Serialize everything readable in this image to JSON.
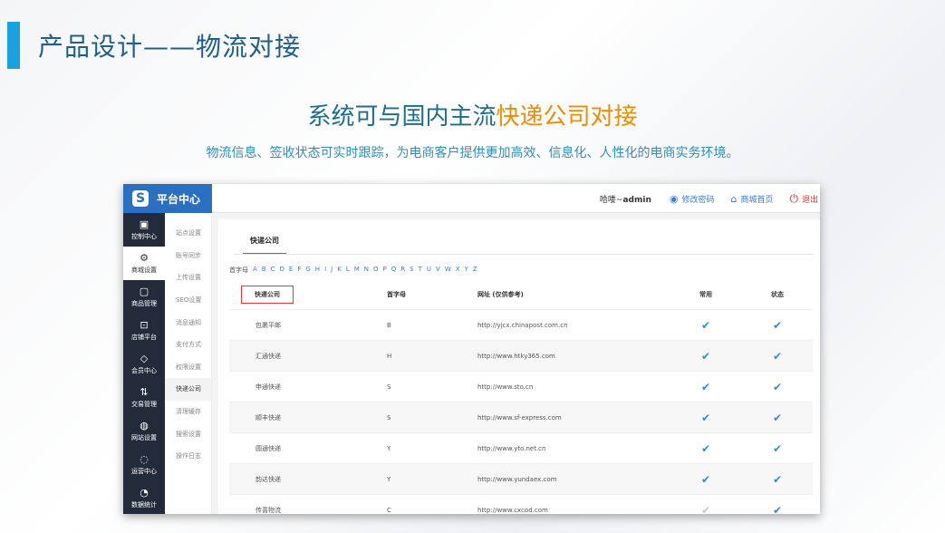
{
  "slide": {
    "title": "产品设计——物流对接",
    "headline_part1": "系统可与国内主流",
    "headline_part2": "快递公司对接",
    "subtitle": "物流信息、签收状态可实时跟踪，为电商客户提供更加高效、信息化、人性化的电商实务环境。"
  },
  "app": {
    "brand_logo": "S",
    "brand_title": "平台中心",
    "user_prefix": "哈喽~",
    "user_name": "admin",
    "change_password": "修改密码",
    "mall_home": "商城首页",
    "logout": "退出"
  },
  "sidebar": {
    "items": [
      {
        "label": "控制中心",
        "icon": "monitor-icon",
        "glyph": "▣"
      },
      {
        "label": "商城设置",
        "icon": "gear-icon",
        "glyph": "⚙"
      },
      {
        "label": "商品管理",
        "icon": "box-icon",
        "glyph": "▢"
      },
      {
        "label": "店铺平台",
        "icon": "store-icon",
        "glyph": "⊡"
      },
      {
        "label": "会员中心",
        "icon": "diamond-icon",
        "glyph": "◇"
      },
      {
        "label": "交易管理",
        "icon": "transfer-icon",
        "glyph": "⇅"
      },
      {
        "label": "网站设置",
        "icon": "globe-icon",
        "glyph": "◍"
      },
      {
        "label": "运营中心",
        "icon": "shield-icon",
        "glyph": "◌"
      },
      {
        "label": "数据统计",
        "icon": "pie-chart-icon",
        "glyph": "◔"
      }
    ]
  },
  "subnav": {
    "items": [
      "站点设置",
      "账号同步",
      "上传设置",
      "SEO设置",
      "消息通知",
      "支付方式",
      "权限设置",
      "快递公司",
      "清理缓存",
      "搜索设置",
      "操作日志"
    ]
  },
  "main": {
    "tab": "快递公司",
    "alpha_label": "首字母",
    "letters": [
      "A",
      "B",
      "C",
      "D",
      "E",
      "F",
      "G",
      "H",
      "I",
      "J",
      "K",
      "L",
      "M",
      "N",
      "O",
      "P",
      "Q",
      "R",
      "S",
      "T",
      "U",
      "V",
      "W",
      "X",
      "Y",
      "Z"
    ],
    "columns": [
      "快递公司",
      "首字母",
      "网址 (仅供参考)",
      "常用",
      "状态"
    ],
    "rows": [
      {
        "name": "包裹平邮",
        "letter": "B",
        "url": "http://yjcx.chinapost.com.cn",
        "common": true,
        "status": true
      },
      {
        "name": "汇通快递",
        "letter": "H",
        "url": "http://www.htky365.com",
        "common": true,
        "status": true
      },
      {
        "name": "申通快递",
        "letter": "S",
        "url": "http://www.sto.cn",
        "common": true,
        "status": true
      },
      {
        "name": "顺丰快递",
        "letter": "S",
        "url": "http://www.sf-express.com",
        "common": true,
        "status": true
      },
      {
        "name": "圆通快递",
        "letter": "Y",
        "url": "http://www.yto.net.cn",
        "common": true,
        "status": true
      },
      {
        "name": "韵达快递",
        "letter": "Y",
        "url": "http://www.yundaex.com",
        "common": true,
        "status": true
      },
      {
        "name": "传喜物流",
        "letter": "C",
        "url": "http://www.cxcod.com",
        "common": false,
        "status": true
      }
    ]
  },
  "colors": {
    "accent": "#2a6fc1",
    "check": "#2a8fd6",
    "highlight": "#f08c00",
    "sidebar": "#232b3a"
  }
}
